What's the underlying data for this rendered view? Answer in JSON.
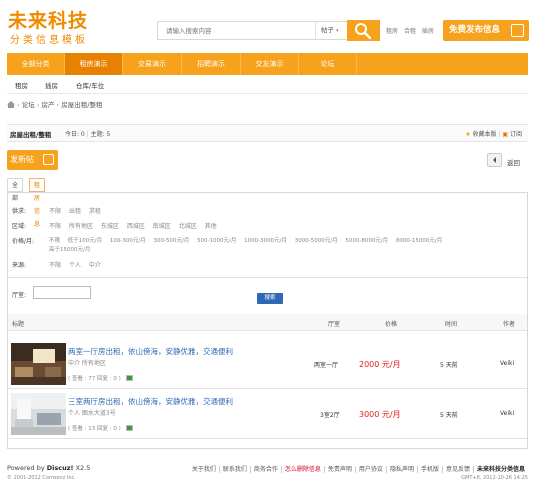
{
  "header": {
    "logo_title": "未来科技",
    "logo_subtitle": "分类信息模板",
    "search_placeholder": "请输入搜索内容",
    "search_type": "帖子",
    "hot_words": [
      "租房",
      "合租",
      "插房"
    ],
    "publish_button": "免费发布信息"
  },
  "nav": {
    "items": [
      "全部分类",
      "租房演示",
      "交易演示",
      "招聘演示",
      "交友演示",
      "论坛"
    ],
    "active_index": 1
  },
  "subnav": {
    "items": [
      "租房",
      "插房",
      "仓库/车位"
    ]
  },
  "breadcrumb": {
    "items": [
      "论坛",
      "房产",
      "房屋出租/整租"
    ]
  },
  "forum": {
    "title": "房屋出租/整租",
    "today": "今日: 0",
    "topics": "主题: 5",
    "favorite": "收藏本版",
    "subscribe": "订阅"
  },
  "actions": {
    "new_post": "发新帖",
    "back": "返回"
  },
  "filter_tabs": [
    "全部",
    "租房信息"
  ],
  "filters": [
    {
      "label": "供求:",
      "options": [
        "不限",
        "出租",
        "求租"
      ]
    },
    {
      "label": "区域:",
      "options": [
        "不限",
        "所有地区",
        "东城区",
        "西城区",
        "南城区",
        "北城区",
        "其他"
      ]
    },
    {
      "label": "价格/月:",
      "options": [
        "不限",
        "低于100元/月",
        "100-300元/月",
        "300-500元/月",
        "500-1000元/月",
        "1000-3000元/月",
        "3000-5000元/月",
        "5000-8000元/月",
        "8000-15000元/月"
      ],
      "options_line2": [
        "高于15000元/月"
      ]
    },
    {
      "label": "来源:",
      "options": [
        "不限",
        "个人",
        "中介"
      ]
    }
  ],
  "hall_label": "厅室:",
  "search_button": "搜索",
  "table_headers": {
    "title": "标题",
    "hall": "厅室",
    "price": "价格",
    "time": "时间",
    "author": "作者"
  },
  "posts": [
    {
      "title": "两室一厅房出租，依山傍海，安静优雅，交通便利",
      "info": "中介 所有地区",
      "stats": "( 查看 : 77 回复 : 0 )",
      "hall": "两室一厅",
      "price": "2000 元/月",
      "time": "5 天前",
      "author": "Veiki"
    },
    {
      "title": "三室两厅房出租，依山傍海，安静优雅，交通便利",
      "info": "个人 图水大道3号",
      "stats": "( 查看 : 13 回复 : 0 )",
      "hall": "3室2厅",
      "price": "3000 元/月",
      "time": "5 天前",
      "author": "Veiki"
    }
  ],
  "footer": {
    "powered": "Powered by",
    "brand": "Discuz!",
    "version": "X2.5",
    "copyright": "© 2001-2012 Comsenz Inc.",
    "links": [
      "关于我们",
      "联系我们",
      "商务合作",
      "怎么删除信息",
      "免责声明",
      "用户协议",
      "隐私声明",
      "手机版",
      "意见反馈",
      "未来科技分类信息"
    ],
    "time": "GMT+8, 2012-10-26 14:25"
  }
}
